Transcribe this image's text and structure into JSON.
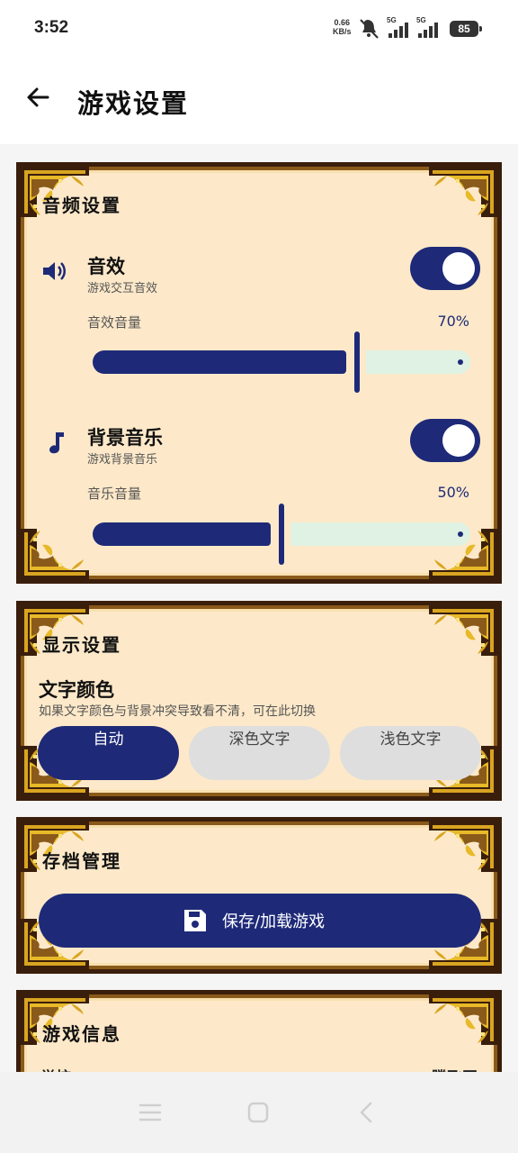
{
  "status": {
    "time": "3:52",
    "net_speed_value": "0.66",
    "net_speed_unit": "KB/s",
    "sim1": "5G",
    "sim2": "5G",
    "battery": "85"
  },
  "header": {
    "title": "游戏设置",
    "back_icon": "arrow-left-icon"
  },
  "audio": {
    "title": "音频设置",
    "sfx": {
      "title": "音效",
      "subtitle": "游戏交互音效",
      "enabled": true,
      "volume_label": "音效音量",
      "volume_text": "70%",
      "volume": 0.7
    },
    "music": {
      "title": "背景音乐",
      "subtitle": "游戏背景音乐",
      "enabled": true,
      "volume_label": "音乐音量",
      "volume_text": "50%",
      "volume": 0.5
    }
  },
  "display": {
    "title": "显示设置",
    "text_color_title": "文字颜色",
    "text_color_desc": "如果文字颜色与背景冲突导致看不清，可在此切换",
    "options": [
      "自动",
      "深色文字",
      "浅色文字"
    ],
    "selected": "自动"
  },
  "save": {
    "title": "存档管理",
    "button_label": "保存/加载游戏"
  },
  "info": {
    "title": "游戏信息",
    "row_left": "学校",
    "row_right": "腾飞网"
  },
  "colors": {
    "accent": "#1e2a78",
    "panel_bg": "#fde9c9",
    "frame": "#3a1e0c",
    "slider_rest": "#dff2e3"
  }
}
